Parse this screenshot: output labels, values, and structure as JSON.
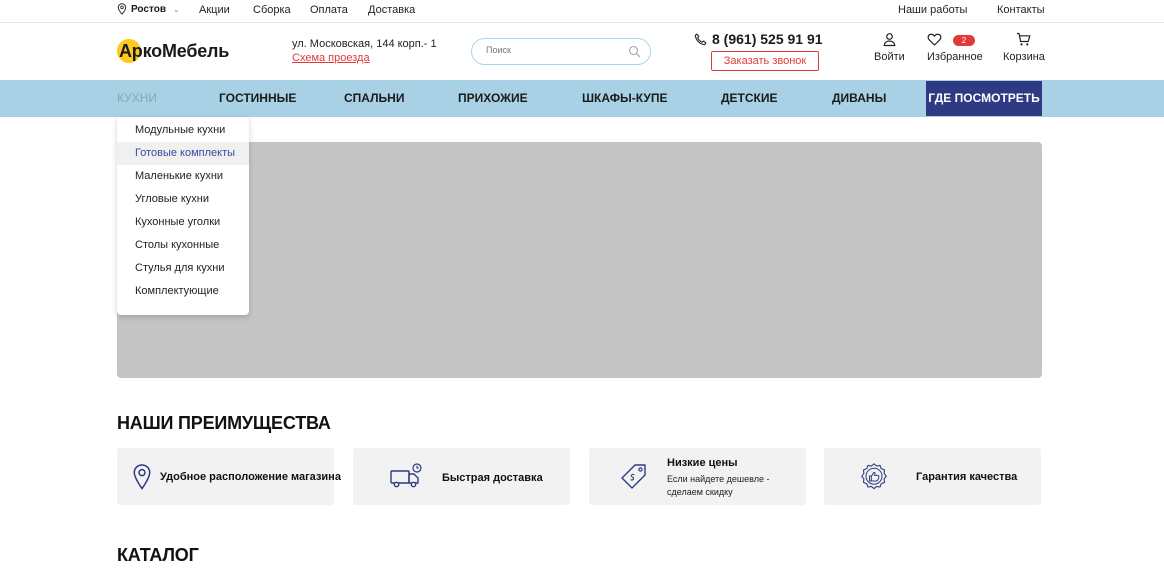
{
  "topbar": {
    "city": "Ростов",
    "links": [
      "Акции",
      "Сборка",
      "Оплата",
      "Доставка"
    ],
    "right_links": [
      "Наши работы",
      "Контакты"
    ]
  },
  "header": {
    "logo": "АркоМебель",
    "address_line": "ул. Московская, 144 корп.- 1",
    "map_link": "Схема проезда",
    "search_placeholder": "Поиск",
    "phone": "8 (961) 525 91 91",
    "call_button": "Заказать звонок",
    "login": "Войти",
    "favorites": "Избранное",
    "favorites_count": "2",
    "cart": "Корзина"
  },
  "nav": {
    "items": [
      "КУХНИ",
      "ГОСТИННЫЕ",
      "СПАЛЬНИ",
      "ПРИХОЖИЕ",
      "ШКАФЫ-КУПЕ",
      "ДЕТСКИЕ",
      "ДИВАНЫ"
    ],
    "cta": "ГДЕ ПОСМОТРЕТЬ"
  },
  "dropdown": {
    "items": [
      "Модульные кухни",
      "Готовые комплекты",
      "Маленькие кухни",
      "Угловые кухни",
      "Кухонные уголки",
      "Столы кухонные",
      "Стулья для кухни",
      "Комплектующие"
    ],
    "highlighted": "Готовые комплекты"
  },
  "advantages": {
    "title": "НАШИ ПРЕИМУЩЕСТВА",
    "items": [
      {
        "icon": "location-pin-icon",
        "title": "Удобное расположение магазина",
        "subtitle": ""
      },
      {
        "icon": "delivery-truck-icon",
        "title": "Быстрая доставка",
        "subtitle": ""
      },
      {
        "icon": "price-tag-icon",
        "title": "Низкие цены",
        "subtitle": "Если найдете дешевле - сделаем скидку"
      },
      {
        "icon": "quality-badge-icon",
        "title": "Гарантия качества",
        "subtitle": ""
      }
    ]
  },
  "catalog": {
    "title": "КАТАЛОГ"
  },
  "colors": {
    "accent_red": "#e23a3a",
    "nav_bg": "#a8d1e6",
    "cta_bg": "#2e3a82",
    "logo_yellow": "#ffc81f",
    "card_bg": "#f2f2f2",
    "hero_bg": "#c4c4c4"
  }
}
